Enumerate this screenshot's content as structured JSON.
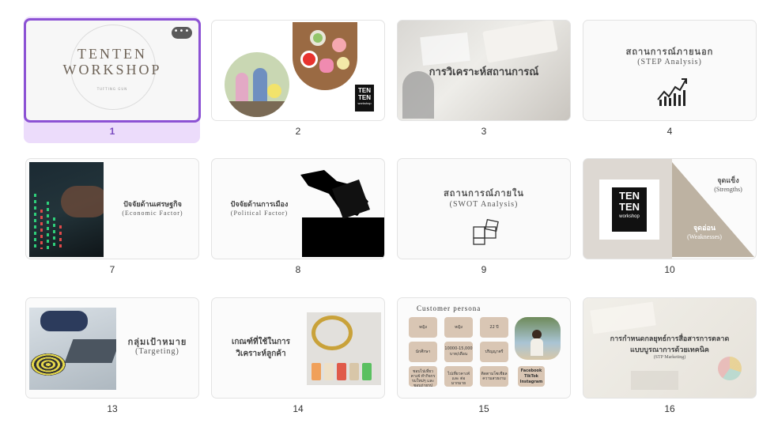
{
  "slides": [
    {
      "number": "1",
      "title_line1": "TENTEN",
      "title_line2": "WORKSHOP",
      "subtitle": "TUFTING GUN",
      "more_label": "•••"
    },
    {
      "number": "2",
      "logo_line1": "TEN",
      "logo_line2": "TEN",
      "logo_line3": "workshop"
    },
    {
      "number": "3",
      "title": "การวิเคราะห์สถานการณ์"
    },
    {
      "number": "4",
      "title": "สถานการณ์ภายนอก",
      "subtitle": "(STEP Analysis)"
    },
    {
      "number": "7",
      "title": "ปัจจัยด้านเศรษฐกิจ",
      "subtitle": "(Economic Factor)"
    },
    {
      "number": "8",
      "title": "ปัจจัยด้านการเมือง",
      "subtitle": "(Political Factor)"
    },
    {
      "number": "9",
      "title": "สถานการณ์ภายใน",
      "subtitle": "(SWOT Analysis)"
    },
    {
      "number": "10",
      "logo_line1": "TEN",
      "logo_line2": "TEN",
      "logo_line3": "workshop",
      "strength_th": "จุดแข็ง",
      "strength_en": "(Strengths)",
      "weak_th": "จุดอ่อน",
      "weak_en": "(Weaknesses)"
    },
    {
      "number": "13",
      "title": "กลุ่มเป้าหมาย",
      "subtitle": "(Targeting)"
    },
    {
      "number": "14",
      "title_line1": "เกณฑ์ที่ใช้ในการ",
      "title_line2": "วิเคราะห์ลูกค้า"
    },
    {
      "number": "15",
      "title": "Customer persona",
      "pills": [
        "หญิง",
        "หญิง",
        "22 ปี",
        "นักศึกษา",
        "10000-15,000 บาท/เดือน",
        "ปริญญาตรี",
        "ชอบไปเที่ยวคาเฟ่ ทำกิจกรรมใหม่ๆ และชอบถ่ายรูป",
        "ไปเที่ยวคาเฟ่และ ต่อ มากมาย",
        "ติดตามโซเชียล ความสวยงาม"
      ],
      "social": [
        "Facebook",
        "TikTok",
        "Instagram"
      ]
    },
    {
      "number": "16",
      "title_line1": "การกำหนดกลยุทธ์การสื่อสารการตลาด",
      "title_line2": "แบบบูรณาการด้วยเทคนิค",
      "subtitle": "(STP Marketing)"
    }
  ]
}
